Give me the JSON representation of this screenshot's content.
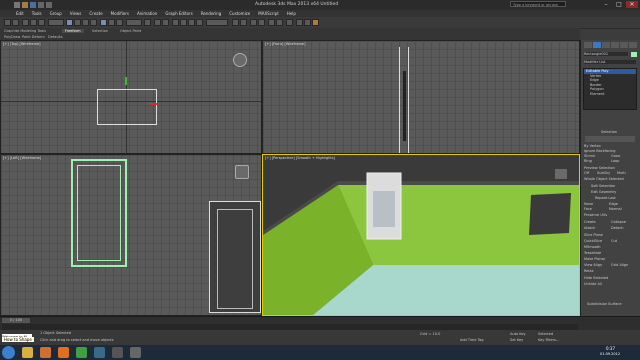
{
  "window": {
    "title": "Autodesk 3ds Max 2013 x64    Untitled",
    "search_placeholder": "Type a keyword or phrase",
    "controls": [
      "–",
      "□",
      "✕"
    ]
  },
  "menu": [
    "Edit",
    "Tools",
    "Group",
    "Views",
    "Create",
    "Modifiers",
    "Animation",
    "Graph Editors",
    "Rendering",
    "Customize",
    "MAXScript",
    "Help"
  ],
  "ribbon": {
    "tabs": [
      "Graphite Modeling Tools",
      "Freeform",
      "Selection",
      "Object Paint"
    ],
    "active_tab": "Freeform",
    "sub_items": [
      "PolyDraw",
      "Paint Deform",
      "Defaults"
    ]
  },
  "viewports": {
    "top_label": "[+] [Top] [Wireframe]",
    "front_label": "[+] [Front] [Wireframe]",
    "left_label": "[+] [Left] [Wireframe]",
    "persp_label": "[+] [Perspective] [Smooth + Highlights]"
  },
  "command_panel": {
    "object_name": "Rectangle001",
    "modifier_list": "Modifier List",
    "stack": [
      "Editable Poly",
      "Vertex",
      "Edge",
      "Border",
      "Polygon",
      "Element"
    ],
    "selected_stack": "Editable Poly",
    "rollouts": [
      "Selection",
      "Soft Selection",
      "Edit Geometry",
      "Subdivision Surface"
    ],
    "options": [
      "By Vertex",
      "Ignore Backfacing",
      "Shrink",
      "Grow",
      "Ring",
      "Loop"
    ],
    "preview_label": "Preview Selection",
    "preview_options": [
      "Off",
      "SubObj",
      "Multi"
    ],
    "whole_object": "Whole Object Selected",
    "constraints": [
      "None",
      "Edge",
      "Face",
      "Normal"
    ],
    "preserve_uvs": "Preserve UVs",
    "repeat_last": "Repeat Last",
    "create": "Create",
    "collapse": "Collapse",
    "attach": "Attach",
    "detach": "Detach",
    "slice_plane": "Slice Plane",
    "quickslice": "QuickSlice",
    "cut": "Cut",
    "msmooth": "MSmooth",
    "tessellate": "Tessellate",
    "make_planar": "Make Planar",
    "view_align": "View Align",
    "grid_align": "Grid Align",
    "relax": "Relax",
    "hide_selected": "Hide Selected",
    "unhide_all": "Unhide All"
  },
  "timeline": {
    "frame": "0 / 100",
    "ticks": [
      "0",
      "10",
      "20",
      "30",
      "40",
      "50",
      "60",
      "70",
      "80",
      "90",
      "100"
    ]
  },
  "status": {
    "selected": "1 Object Selected",
    "prompt": "Click and drag to select and move objects",
    "grid": "Grid = 10.0",
    "auto_key": "Auto Key",
    "set_key": "Set Key",
    "selected_dropdown": "Selected",
    "key_filters": "Key Filters...",
    "add_time_tag": "Add Time Tag",
    "welcome": "Welcome to M"
  },
  "taskbar": {
    "clock_time": "0:37",
    "clock_date": "01.09.2012",
    "tooltip": "How to Shape"
  },
  "colors": {
    "accent_green": "#7ab32a",
    "wall_green": "#8cc63f",
    "floor": "#a8d8cc",
    "selection_outline": "#a0f0b0"
  }
}
